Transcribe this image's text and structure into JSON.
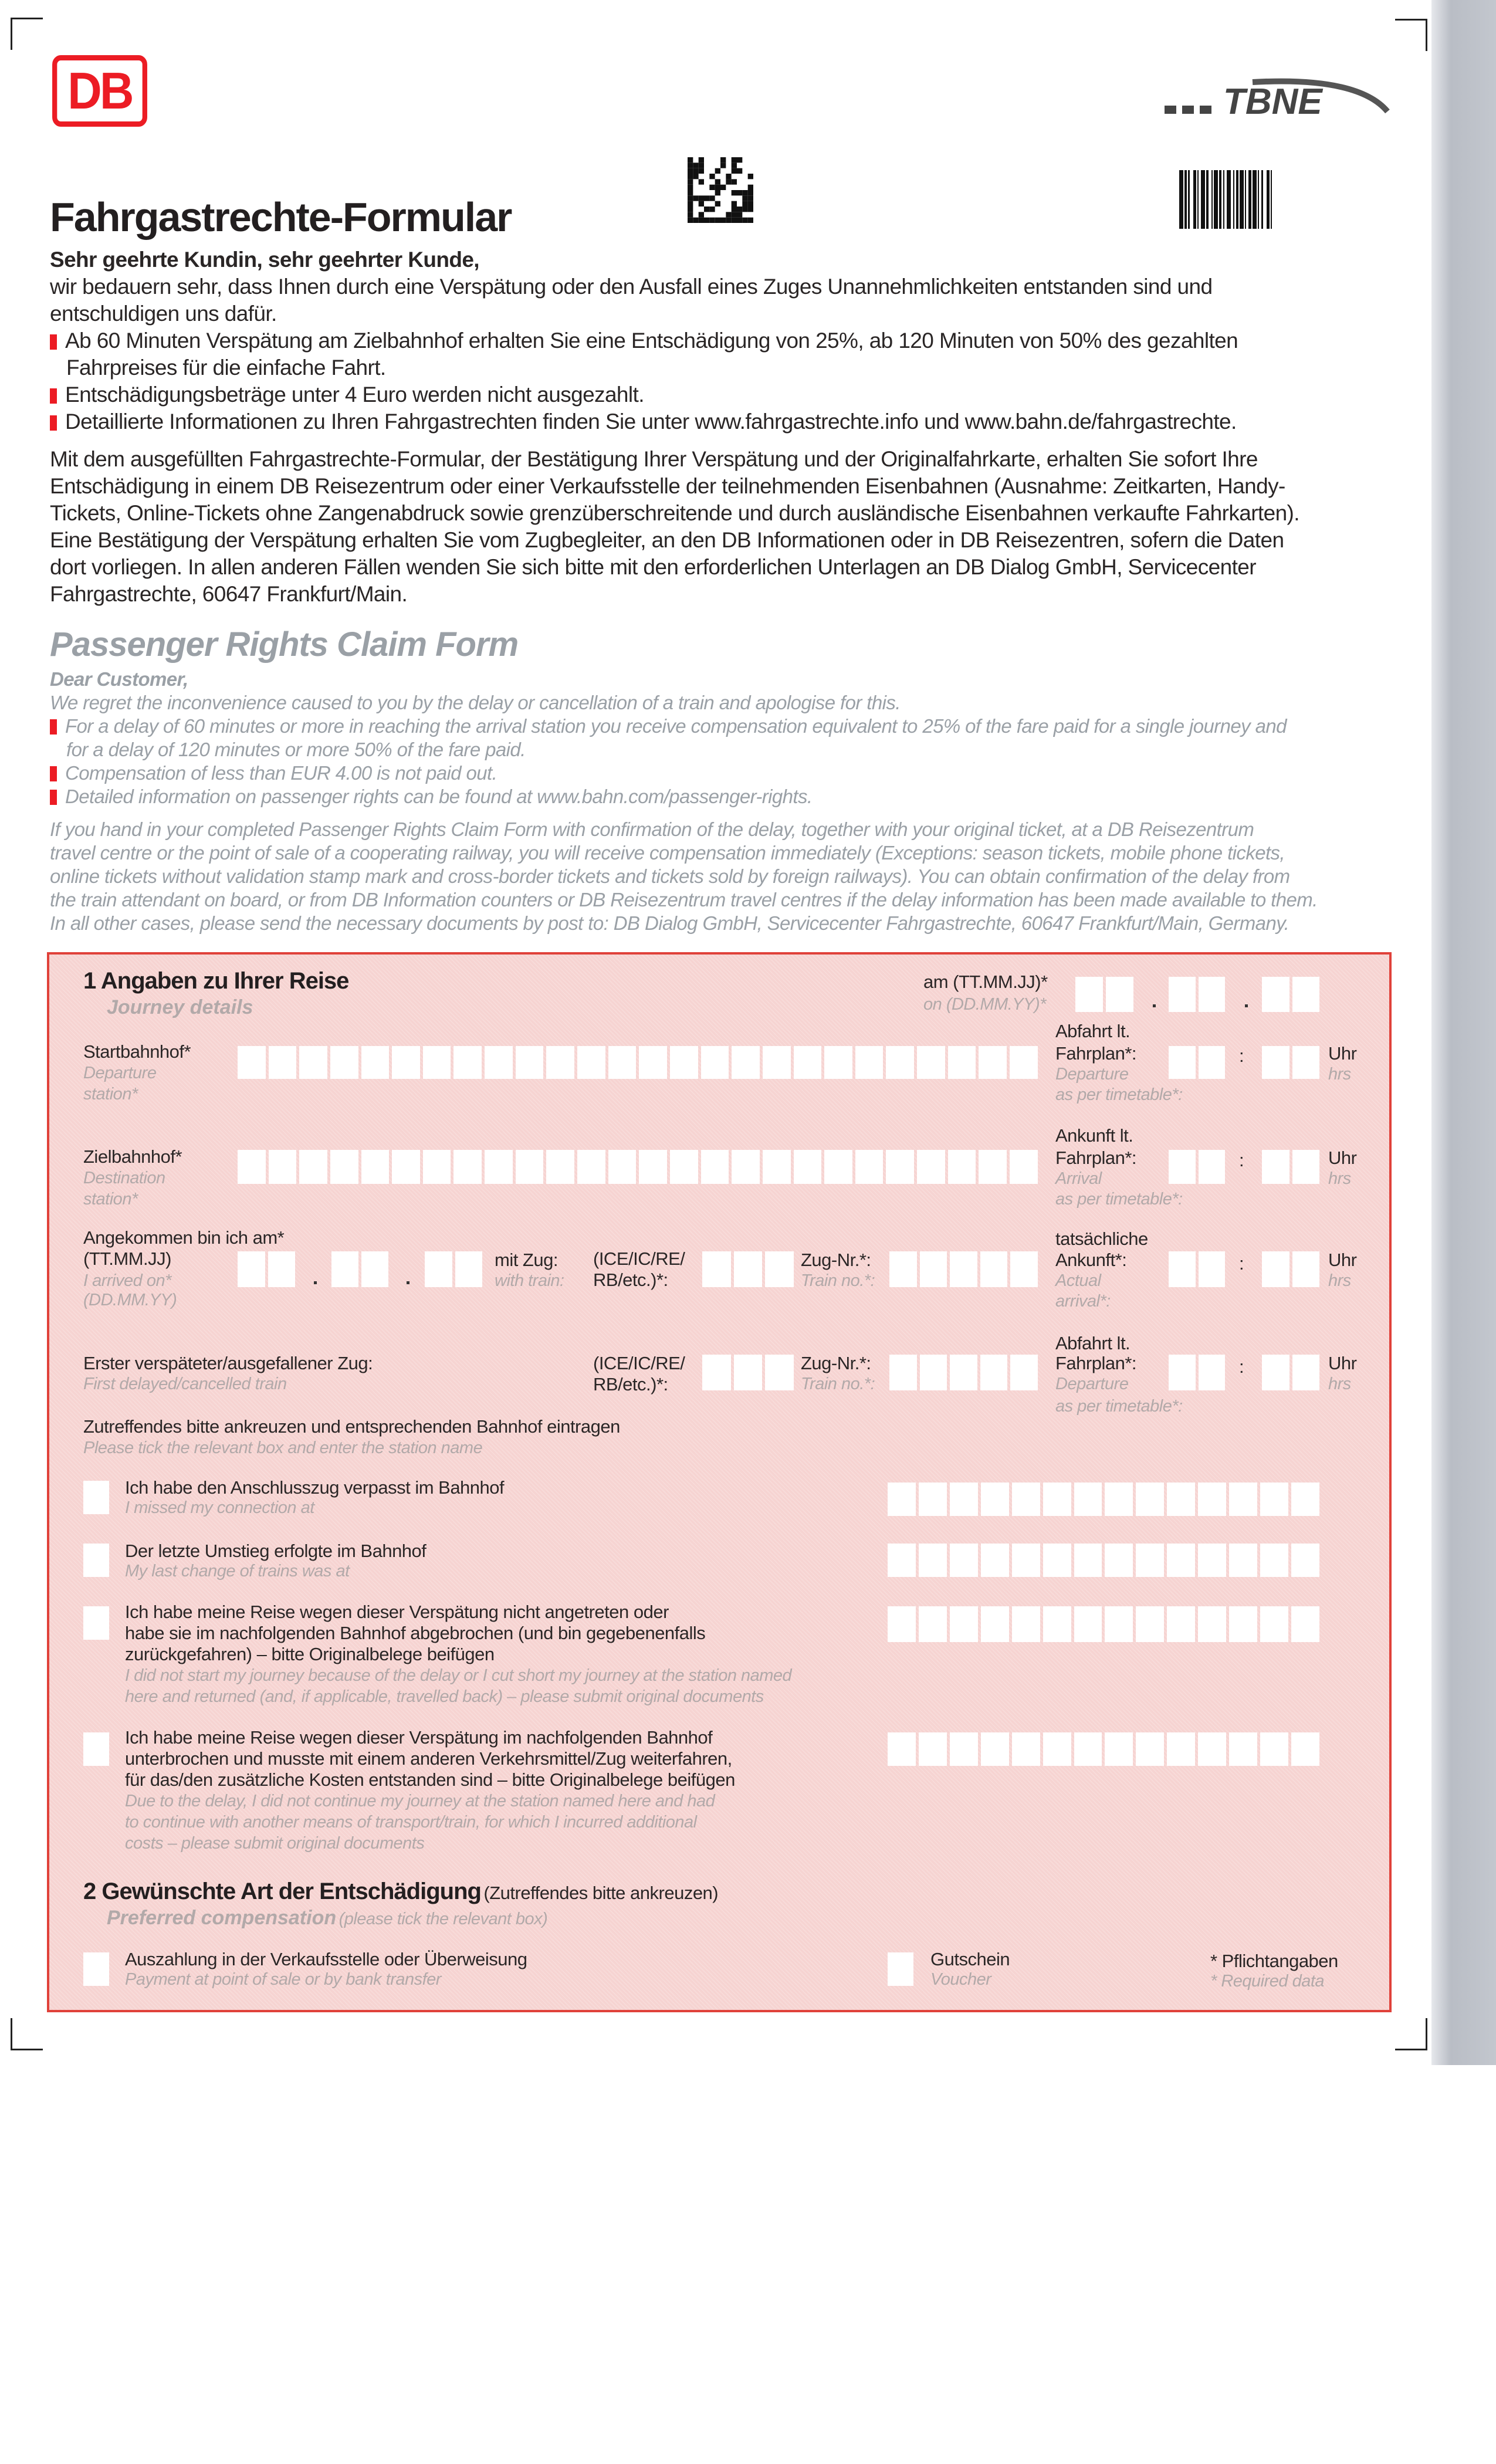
{
  "header": {
    "logo_text": "DB",
    "partner_logo_text": "TBNE",
    "title": "Fahrgastrechte-Formular"
  },
  "german": {
    "greeting": "Sehr geehrte Kundin, sehr geehrter Kunde,",
    "intro": [
      "wir bedauern sehr, dass Ihnen durch eine Verspätung oder den Ausfall eines Zuges Unannehmlichkeiten entstanden sind und",
      "entschuldigen uns dafür."
    ],
    "bullets": [
      [
        "Ab 60 Minuten Verspätung am Zielbahnhof erhalten Sie eine Entschädigung von 25%, ab 120 Minuten von 50% des gezahlten",
        "Fahrpreises für die einfache Fahrt."
      ],
      [
        "Entschädigungsbeträge unter 4 Euro werden nicht ausgezahlt."
      ],
      [
        "Detaillierte Informationen zu Ihren Fahrgastrechten finden Sie unter www.fahrgastrechte.info und www.bahn.de/fahrgastrechte."
      ]
    ],
    "paragraph": [
      "Mit dem ausgefüllten Fahrgastrechte-Formular, der Bestätigung Ihrer Verspätung und der Originalfahrkarte, erhalten Sie sofort Ihre",
      "Entschädigung in einem DB Reisezentrum oder einer Verkaufsstelle der teilnehmenden Eisenbahnen (Ausnahme: Zeitkarten, Handy-",
      "Tickets, Online-Tickets ohne Zangenabdruck sowie grenzüberschreitende und durch ausländische Eisenbahnen verkaufte Fahrkarten).",
      "Eine Bestätigung der Verspätung erhalten Sie vom Zugbegleiter, an den DB Informationen oder in DB Reisezentren, sofern die Daten",
      "dort vorliegen. In allen anderen Fällen wenden Sie sich bitte mit den erforderlichen Unterlagen an DB Dialog GmbH, Servicecenter",
      "Fahrgastrechte, 60647 Frankfurt/Main."
    ]
  },
  "english": {
    "title": "Passenger Rights Claim Form",
    "greeting": "Dear Customer,",
    "intro": "We regret the inconvenience caused to you by the delay or cancellation of a train and apologise for this.",
    "bullets": [
      [
        "For a delay of 60 minutes or more in reaching the arrival station you receive compensation equivalent to 25% of the fare paid for a single journey and",
        "for a delay of 120 minutes or more 50% of the fare paid."
      ],
      [
        "Compensation of less than EUR 4.00 is not paid out."
      ],
      [
        "Detailed information on passenger rights can be found at www.bahn.com/passenger-rights."
      ]
    ],
    "paragraph": [
      "If you hand in your completed Passenger Rights Claim Form with confirmation of the delay, together with your original ticket, at a DB Reisezentrum",
      "travel centre or the point of sale of a cooperating railway, you will receive compensation immediately (Exceptions: season tickets, mobile phone tickets,",
      "online tickets without validation stamp mark and cross-border tickets and tickets sold by foreign railways). You can obtain confirmation of the delay from",
      "the train attendant on board, or from DB Information counters or DB Reisezentrum travel centres if the delay information has been made available to them.",
      "In all other cases, please send the necessary documents by post to: DB Dialog GmbH, Servicecenter Fahrgastrechte, 60647 Frankfurt/Main, Germany."
    ]
  },
  "form": {
    "s1": {
      "title": "1  Angaben zu Ihrer Reise",
      "subtitle": "Journey details",
      "date_de": "am (TT.MM.JJ)*",
      "date_en": "on (DD.MM.YY)*"
    },
    "start": {
      "de": "Startbahnhof*",
      "en1": "Departure",
      "en2": "station*",
      "t1": "Abfahrt lt.",
      "t2": "Fahrplan*:",
      "t3": "Departure",
      "t4": "as per timetable*:"
    },
    "dest": {
      "de": "Zielbahnhof*",
      "en1": "Destination",
      "en2": "station*",
      "t1": "Ankunft lt.",
      "t2": "Fahrplan*:",
      "t3": "Arrival",
      "t4": "as per timetable*:"
    },
    "arrived": {
      "de1": "Angekommen bin ich am*",
      "de2": "(TT.MM.JJ)",
      "en1": "I arrived on*",
      "en2": "(DD.MM.YY)",
      "train_de": "mit Zug:",
      "train_en": "with train:",
      "type1": "(ICE/IC/RE/",
      "type2": "RB/etc.)*:",
      "no_de": "Zug-Nr.*:",
      "no_en": "Train no.*:",
      "t1": "tatsächliche",
      "t2": "Ankunft*:",
      "t3": "Actual",
      "t4": "arrival*:"
    },
    "first": {
      "de": "Erster verspäteter/ausgefallener Zug:",
      "en": "First delayed/cancelled train",
      "type1": "(ICE/IC/RE/",
      "type2": "RB/etc.)*:",
      "no_de": "Zug-Nr.*:",
      "no_en": "Train no.*:",
      "t1": "Abfahrt lt.",
      "t2": "Fahrplan*:",
      "t3": "Departure",
      "t4": "as per timetable*:"
    },
    "time_unit_de": "Uhr",
    "time_unit_en": "hrs",
    "tick": {
      "de": "Zutreffendes bitte ankreuzen und entsprechenden Bahnhof eintragen",
      "en": "Please tick the relevant box and enter the station name"
    },
    "options": [
      {
        "de": [
          "Ich habe den Anschlusszug verpasst im Bahnhof"
        ],
        "en": [
          "I missed my connection at"
        ]
      },
      {
        "de": [
          "Der letzte Umstieg erfolgte im Bahnhof"
        ],
        "en": [
          "My last change of trains was at"
        ]
      },
      {
        "de": [
          "Ich habe meine Reise wegen dieser Verspätung nicht angetreten oder",
          "habe sie im nachfolgenden Bahnhof abgebrochen (und bin gegebenenfalls",
          "zurückgefahren) – bitte Originalbelege beifügen"
        ],
        "en": [
          "I did not start my journey because of the delay or I cut short my journey at the station named",
          "here and returned (and, if applicable, travelled back) – please submit original documents"
        ]
      },
      {
        "de": [
          "Ich habe meine Reise wegen dieser Verspätung im nachfolgenden Bahnhof",
          "unterbrochen und musste mit einem anderen Verkehrsmittel/Zug weiterfahren,",
          "für das/den zusätzliche Kosten entstanden sind – bitte Originalbelege beifügen"
        ],
        "en": [
          "Due to the delay, I did not continue my journey at the station named here and had",
          "to continue with another means of transport/train, for which I incurred additional",
          "costs – please submit original documents"
        ]
      }
    ],
    "s2": {
      "title": "2  Gewünschte Art der Entschädigung",
      "title_note": "(Zutreffendes bitte ankreuzen)",
      "subtitle": "Preferred compensation",
      "subtitle_note": "(please tick the relevant box)"
    },
    "payment": {
      "de": "Auszahlung in der Verkaufsstelle oder Überweisung",
      "en": "Payment at point of sale or by bank transfer"
    },
    "voucher": {
      "de": "Gutschein",
      "en": "Voucher"
    },
    "required": {
      "de": "* Pflichtangaben",
      "en": "* Required data"
    }
  },
  "colors": {
    "brand_red": "#ec1c24",
    "form_bg": "#f6d3d1",
    "form_border": "#e0413a",
    "english_text": "#9aa0a6"
  }
}
